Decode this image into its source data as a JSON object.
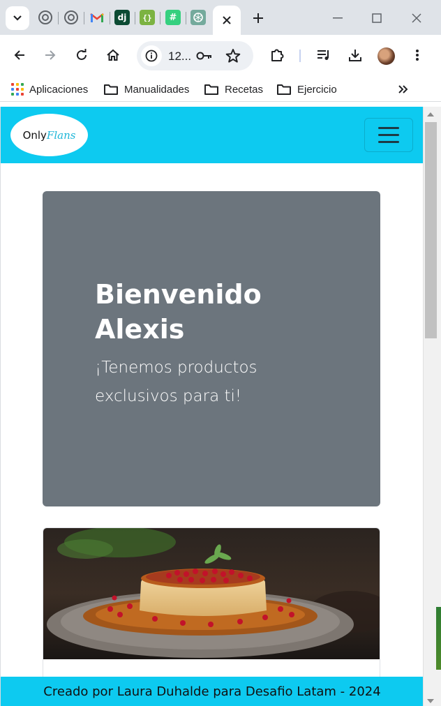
{
  "browser": {
    "address_text": "12...",
    "window_controls": [
      "minimize-icon",
      "maximize-icon",
      "close-icon"
    ],
    "tab_favicons": [
      "github-icon",
      "github-icon",
      "gmail-icon",
      "django-icon",
      "json-icon",
      "hash-icon",
      "chatgpt-icon"
    ],
    "active_tab_icon": "close-icon"
  },
  "bookmarks": {
    "items": [
      {
        "label": "Aplicaciones",
        "icon": "apps-grid-icon"
      },
      {
        "label": "Manualidades",
        "icon": "folder-icon"
      },
      {
        "label": "Recetas",
        "icon": "folder-icon"
      },
      {
        "label": "Ejercicio",
        "icon": "folder-icon"
      }
    ],
    "overflow_icon": "chevron-double-right-icon"
  },
  "site": {
    "logo_prefix": "Only",
    "logo_suffix": "Flans",
    "brand_color": "#0dcaf0",
    "hero": {
      "title": "Bienvenido Alexis",
      "subtitle": "¡Tenemos productos exclusivos para ti!",
      "bg_color": "#6c757d"
    },
    "card_image": "flan-with-pomegranate-image",
    "footer_text": "Creado por Laura Duhalde para Desafio Latam - 2024"
  }
}
